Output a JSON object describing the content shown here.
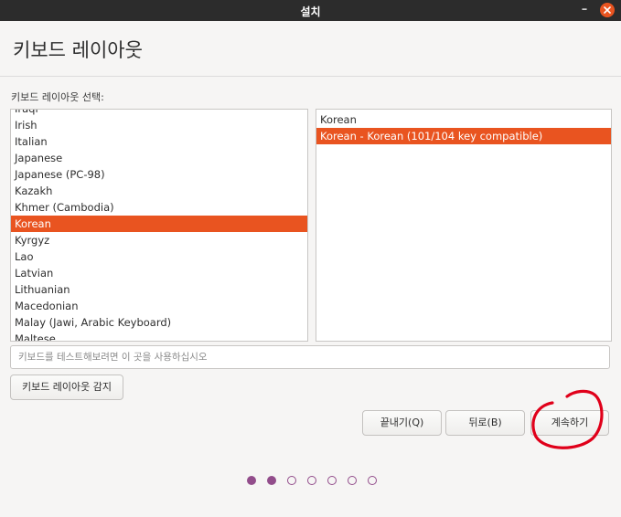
{
  "window": {
    "title": "설치"
  },
  "page": {
    "title": "키보드 레이아웃",
    "select_label": "키보드 레이아웃 선택:"
  },
  "layouts": {
    "items": [
      "Iraqi",
      "Irish",
      "Italian",
      "Japanese",
      "Japanese (PC-98)",
      "Kazakh",
      "Khmer (Cambodia)",
      "Korean",
      "Kyrgyz",
      "Lao",
      "Latvian",
      "Lithuanian",
      "Macedonian",
      "Malay (Jawi, Arabic Keyboard)",
      "Maltese"
    ],
    "selected": "Korean"
  },
  "variants": {
    "items": [
      "Korean",
      "Korean - Korean (101/104 key compatible)"
    ],
    "selected": "Korean - Korean (101/104 key compatible)"
  },
  "test_input": {
    "placeholder": "키보드를 테스트해보려면 이 곳을 사용하십시오",
    "value": ""
  },
  "buttons": {
    "detect": "키보드 레이아웃 감지",
    "quit": "끝내기(Q)",
    "back": "뒤로(B)",
    "continue": "계속하기"
  },
  "progress": {
    "total_steps": 7,
    "current_step": 2
  },
  "colors": {
    "accent": "#e95420",
    "progress_dot": "#924d8b",
    "annotation": "#e0001a"
  },
  "annotation": {
    "shape": "red hand-drawn circle around continue button"
  }
}
